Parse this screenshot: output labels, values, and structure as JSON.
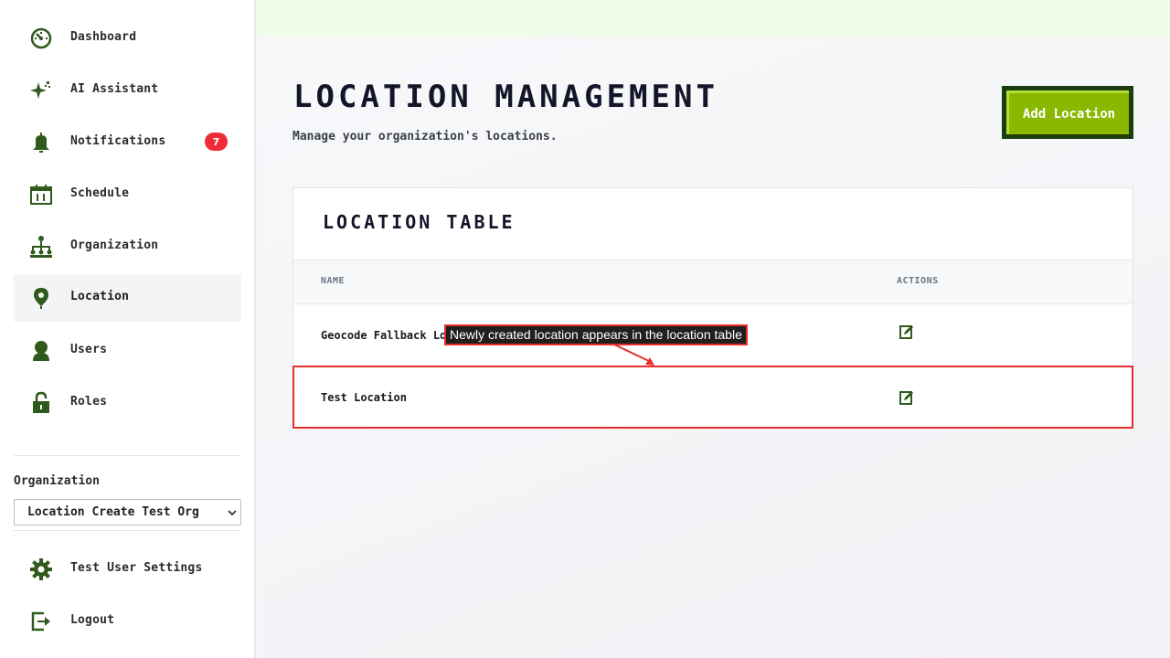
{
  "sidebar": {
    "items": [
      {
        "label": "Dashboard",
        "icon": "dashboard-icon"
      },
      {
        "label": "AI Assistant",
        "icon": "sparkle-icon"
      },
      {
        "label": "Notifications",
        "icon": "bell-icon",
        "badge": "7"
      },
      {
        "label": "Schedule",
        "icon": "calendar-icon"
      },
      {
        "label": "Organization",
        "icon": "org-chart-icon"
      },
      {
        "label": "Location",
        "icon": "location-pin-icon",
        "active": true
      },
      {
        "label": "Users",
        "icon": "user-icon"
      },
      {
        "label": "Roles",
        "icon": "lock-icon"
      }
    ],
    "organization_label": "Organization",
    "organization_selected": "Location Create Test Org",
    "footer_items": [
      {
        "label": "Test User Settings",
        "icon": "gear-icon"
      },
      {
        "label": "Logout",
        "icon": "logout-icon"
      }
    ]
  },
  "header": {
    "title": "LOCATION MANAGEMENT",
    "subtitle": "Manage your organization's locations.",
    "add_button_label": "Add Location"
  },
  "table": {
    "title": "LOCATION TABLE",
    "columns": [
      "NAME",
      "ACTIONS"
    ],
    "rows": [
      {
        "name": "Geocode Fallback Loc"
      },
      {
        "name": "Test Location"
      }
    ]
  },
  "annotation": {
    "text": "Newly created location appears in the location table"
  },
  "colors": {
    "brand_green": "#2f5a1c",
    "button_green": "#8ab800",
    "badge_red": "#ef2b3a",
    "highlight_red": "#e62e2e"
  }
}
